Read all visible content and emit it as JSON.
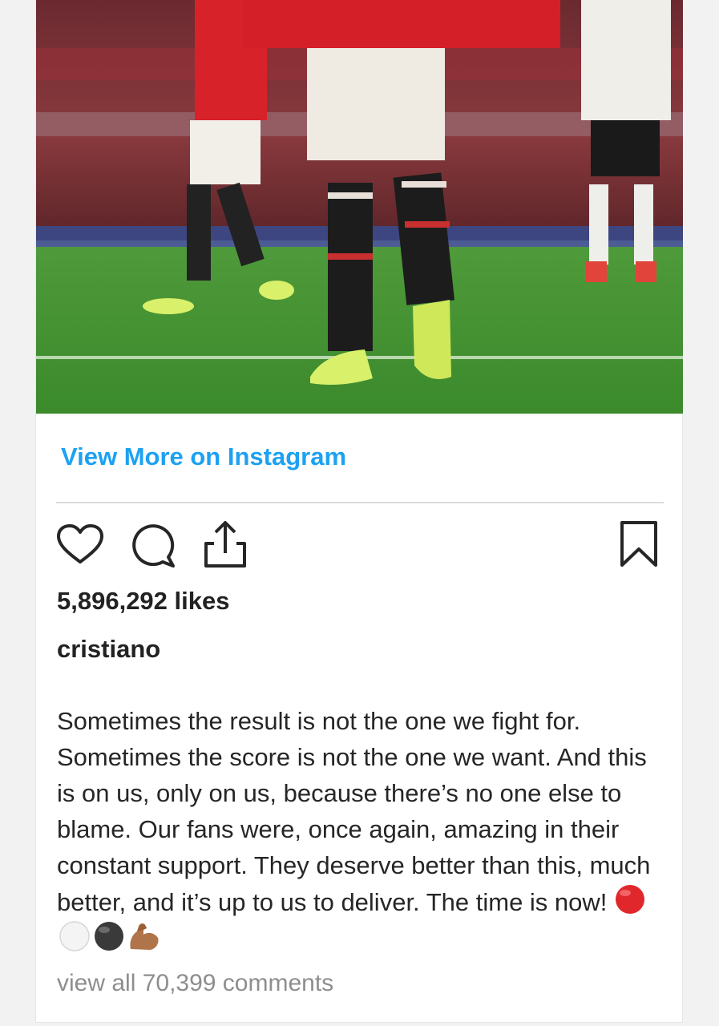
{
  "post": {
    "view_more_label": "View More on Instagram",
    "likes": "5,896,292 likes",
    "username": "cristiano",
    "caption": "Sometimes the result is not the one we fight for. Sometimes the score is not the one we want. And this is on us, only on us, because there’s no one else to blame. Our fans were, once again, amazing in their constant support. They deserve better than this, much better, and it’s up to us to deliver. The time is now!",
    "view_comments": "view all 70,399 comments"
  },
  "caption_emojis": [
    "red-circle",
    "white-circle",
    "black-circle",
    "flexed-biceps"
  ],
  "icons": {
    "like": "heart-icon",
    "comment": "comment-bubble-icon",
    "share": "share-upload-icon",
    "save": "bookmark-icon"
  },
  "colors": {
    "link": "#1da1f2",
    "text": "#262626",
    "muted": "#8e8e8e"
  }
}
